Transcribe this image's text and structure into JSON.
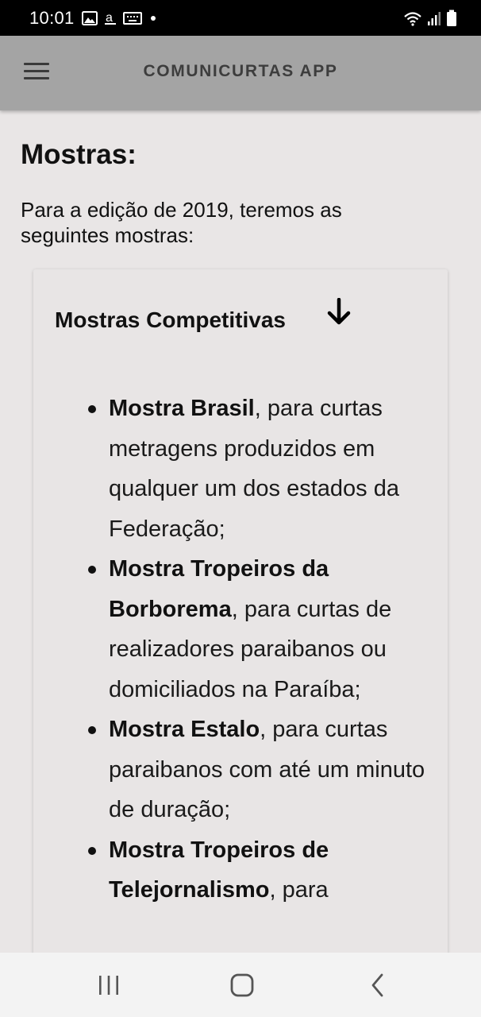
{
  "status_bar": {
    "time": "10:01",
    "left_icons": [
      "image-icon",
      "amazon-icon",
      "keyboard-icon",
      "dot-icon"
    ],
    "right_icons": [
      "wifi-icon",
      "signal-icon",
      "battery-icon"
    ]
  },
  "app_bar": {
    "title": "COMUNICURTAS APP",
    "menu_icon": "hamburger-menu-icon"
  },
  "page": {
    "heading": "Mostras:",
    "intro": "Para a edição de 2019, teremos as seguintes mostras:"
  },
  "card": {
    "title": "Mostras Competitivas",
    "title_icon": "arrow-down-icon",
    "items": [
      {
        "name": "Mostra Brasil",
        "text": ", para curtas metragens produzidos em qualquer um dos estados da Federação;"
      },
      {
        "name": "Mostra Tropeiros da Borborema",
        "text": ", para curtas de realizadores paraibanos ou domiciliados na Paraíba;"
      },
      {
        "name": "Mostra Estalo",
        "text": ", para curtas paraibanos com até um minuto de duração;"
      },
      {
        "name": "Mostra Tropeiros de Telejornalismo",
        "text": ", para"
      }
    ]
  },
  "nav_bar": {
    "icons": [
      "recents-icon",
      "home-icon",
      "back-icon"
    ]
  },
  "colors": {
    "app_bar": "#a4a4a4",
    "background": "#e9e6e6",
    "status_bar": "#000000",
    "nav_bar": "#f3f3f3"
  }
}
